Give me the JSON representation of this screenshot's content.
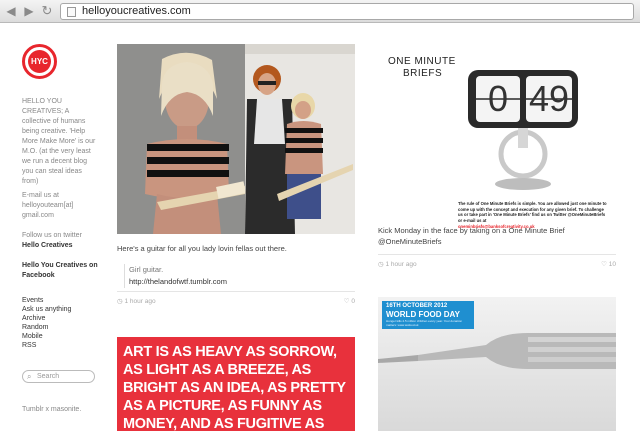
{
  "browser": {
    "url": "helloyoucreatives.com"
  },
  "sidebar": {
    "logo_text": "HYC",
    "bio": "HELLO YOU CREATIVES; A collective of humans being creative. 'Help More Make More' is our M.O. (at the very least we run a decent blog you can steal ideas from)",
    "email_label": "E-mail us at",
    "email": "helloyouteam[at] gmail.com",
    "twitter_label": "Follow us on twitter",
    "twitter_link": "Hello Creatives",
    "facebook_link": "Hello You Creatives on Facebook",
    "nav": [
      "Events",
      "Ask us anything",
      "Archive",
      "Random",
      "Mobile",
      "RSS"
    ],
    "search_placeholder": "Search",
    "credit": "Tumblr x masonite."
  },
  "posts": [
    {
      "caption": "Here's a guitar for all you lady lovin fellas out there.",
      "quote_line1": "Girl guitar.",
      "quote_line2": "http://thelandofwtf.tumblr.com",
      "time": "1 hour ago",
      "notes": "0"
    },
    {
      "poster_text": "ART IS AS HEAVY AS SORROW, AS LIGHT AS A BREEZE, AS BRIGHT AS AN IDEA, AS PRETTY AS A PICTURE, AS FUNNY AS MONEY, AND AS FUGITIVE AS FRAUD!"
    },
    {
      "brand_line1": "ONE MINUTE",
      "brand_line2": "BRIEFS",
      "clock_left": "0",
      "clock_right": "49",
      "brief_text": "The rule of One Minute Briefs is simple. You are allowed just one minute to come up with the concept and execution for any given brief. To challenge us or take part in 'One Minute Briefs' find us on Twitter @OneMinuteBriefs or e-mail us at",
      "brief_email": "oneminbriefs@banksofcreativity.co.uk",
      "caption": "Kick Monday in the face by taking on a One Minute Brief @OneMinuteBriefs",
      "time": "1 hour ago",
      "notes": "10"
    },
    {
      "banner_line1": "16TH OCTOBER 2012",
      "banner_line2": "WORLD FOOD DAY",
      "banner_small": "Hunger kills 2.5 million children every year. Your donation matters: www.wofood.uk"
    }
  ],
  "colors": {
    "accent": "#e8262d",
    "poster_bg": "#e8313c",
    "banner_bg": "#1f8fd0"
  }
}
